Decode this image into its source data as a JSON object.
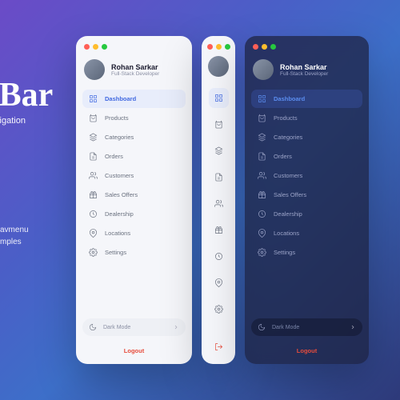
{
  "hero": {
    "title": "eBar",
    "subtitle": "Navigation",
    "desc1": "avmenu",
    "desc2": "mples"
  },
  "user": {
    "name": "Rohan Sarkar",
    "role": "Full-Stack Developer"
  },
  "nav": [
    {
      "label": "Dashboard",
      "icon": "grid",
      "active": true
    },
    {
      "label": "Products",
      "icon": "bag"
    },
    {
      "label": "Categories",
      "icon": "layers"
    },
    {
      "label": "Orders",
      "icon": "file"
    },
    {
      "label": "Customers",
      "icon": "users"
    },
    {
      "label": "Sales Offers",
      "icon": "gift"
    },
    {
      "label": "Dealership",
      "icon": "clock"
    },
    {
      "label": "Locations",
      "icon": "pin"
    },
    {
      "label": "Settings",
      "icon": "gear"
    }
  ],
  "darkmode": {
    "label": "Dark Mode"
  },
  "logout": {
    "label": "Logout"
  }
}
